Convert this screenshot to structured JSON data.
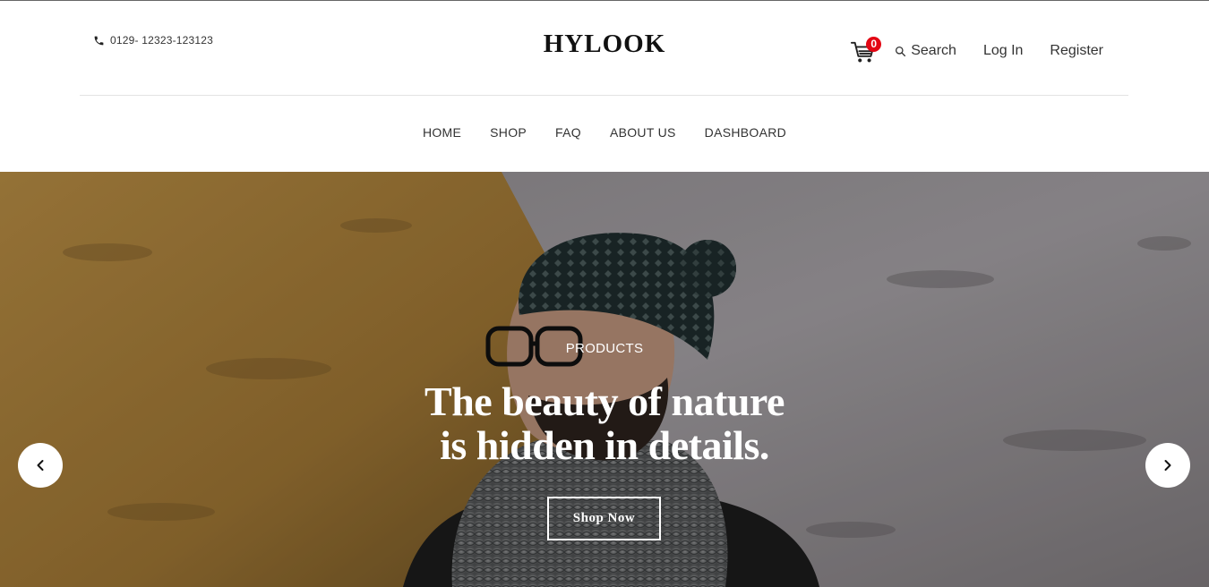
{
  "header": {
    "phone": "0129- 12323-123123",
    "logo": "HYLOOK",
    "cart_count": "0",
    "search_label": "Search",
    "login_label": "Log In",
    "register_label": "Register"
  },
  "menu": {
    "items": [
      "HOME",
      "SHOP",
      "FAQ",
      "ABOUT US",
      "DASHBOARD"
    ]
  },
  "hero": {
    "kicker": "PRODUCTS",
    "title_line1": "The beauty of nature",
    "title_line2": "is hidden in details.",
    "button_label": "Shop Now"
  },
  "colors": {
    "badge": "#e30613",
    "text": "#333333",
    "wall_left": "#b88a3e",
    "wall_right": "#a8a4a7"
  },
  "icons": {
    "phone": "phone-icon",
    "cart": "cart-icon",
    "search": "search-icon",
    "prev": "chevron-left-icon",
    "next": "chevron-right-icon"
  }
}
